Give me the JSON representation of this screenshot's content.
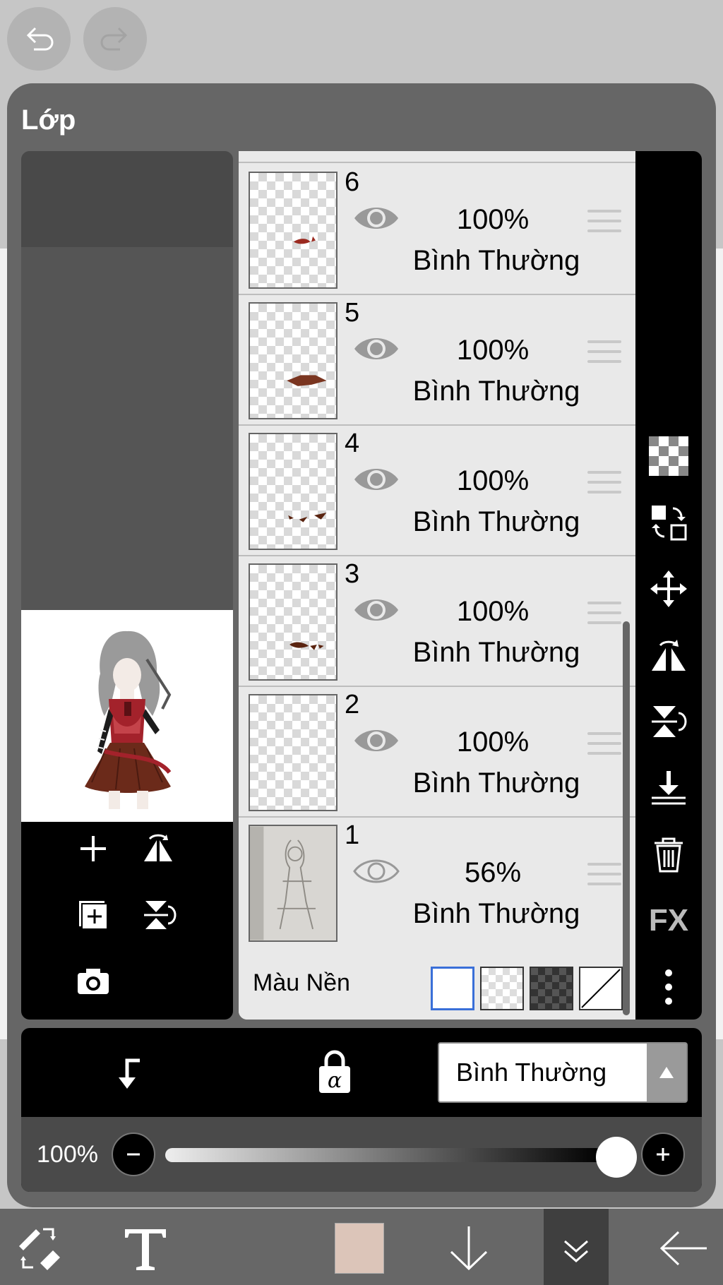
{
  "panel": {
    "title": "Lớp"
  },
  "layers": [
    {
      "number": "6",
      "opacity": "100%",
      "blend": "Bình Thường"
    },
    {
      "number": "5",
      "opacity": "100%",
      "blend": "Bình Thường"
    },
    {
      "number": "4",
      "opacity": "100%",
      "blend": "Bình Thường"
    },
    {
      "number": "3",
      "opacity": "100%",
      "blend": "Bình Thường"
    },
    {
      "number": "2",
      "opacity": "100%",
      "blend": "Bình Thường"
    },
    {
      "number": "1",
      "opacity": "56%",
      "blend": "Bình Thường"
    }
  ],
  "background": {
    "label": "Màu Nền"
  },
  "side_tools": {
    "fx_label": "FX"
  },
  "blend_mode": {
    "selected": "Bình Thường"
  },
  "opacity_control": {
    "value_label": "100%",
    "value": 100
  },
  "current_color": "#dcc5b9",
  "colors": {
    "panel": "#666666",
    "list": "#e9e9e9",
    "toolbar": "#000000"
  }
}
